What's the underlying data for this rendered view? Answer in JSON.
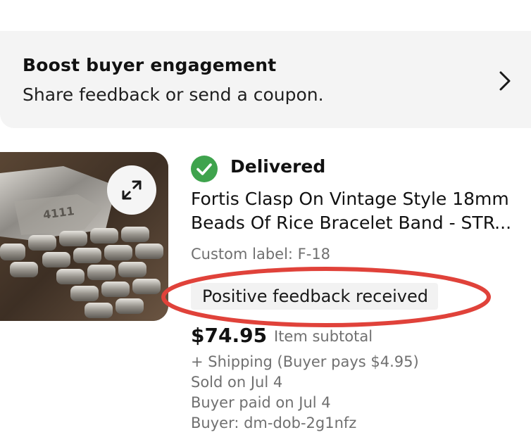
{
  "boost": {
    "title": "Boost buyer engagement",
    "subtitle": "Share feedback or send a coupon.",
    "chevron_icon": "chevron-right-icon"
  },
  "item": {
    "image_alt": "Beads of rice watch bracelet",
    "expand_icon": "expand-icon",
    "status": {
      "icon": "check-circle-icon",
      "color": "#3fa34d",
      "text": "Delivered"
    },
    "title_lines": [
      "Fortis Clasp On Vintage Style 18mm",
      "Beads Of Rice Bracelet Band - STR..."
    ],
    "custom_label": "Custom label: F-18",
    "feedback_badge": "Positive feedback received",
    "annotation_color": "#e0423a",
    "price": "$74.95",
    "price_label": "Item subtotal",
    "shipping": "+ Shipping (Buyer pays $4.95)",
    "sold_on": "Sold on Jul 4",
    "paid_on": "Buyer paid on Jul 4",
    "buyer": "Buyer: dm-dob-2g1nfz"
  }
}
